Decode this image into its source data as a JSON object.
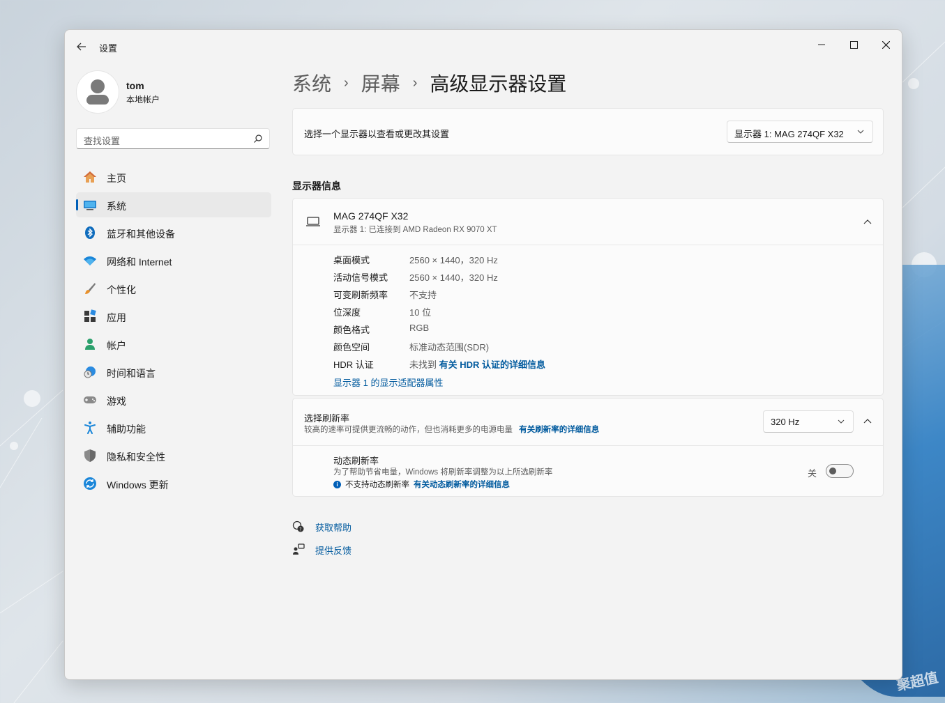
{
  "window": {
    "title": "设置"
  },
  "user": {
    "name": "tom",
    "account_type": "本地帐户"
  },
  "search": {
    "placeholder": "查找设置"
  },
  "nav": {
    "items": [
      {
        "label": "主页",
        "icon": "home-icon"
      },
      {
        "label": "系统",
        "icon": "system-icon",
        "active": true
      },
      {
        "label": "蓝牙和其他设备",
        "icon": "bluetooth-icon"
      },
      {
        "label": "网络和 Internet",
        "icon": "wifi-icon"
      },
      {
        "label": "个性化",
        "icon": "brush-icon"
      },
      {
        "label": "应用",
        "icon": "apps-icon"
      },
      {
        "label": "帐户",
        "icon": "account-icon"
      },
      {
        "label": "时间和语言",
        "icon": "globe-clock-icon"
      },
      {
        "label": "游戏",
        "icon": "gamepad-icon"
      },
      {
        "label": "辅助功能",
        "icon": "accessibility-icon"
      },
      {
        "label": "隐私和安全性",
        "icon": "shield-icon"
      },
      {
        "label": "Windows 更新",
        "icon": "update-icon"
      }
    ]
  },
  "breadcrumb": {
    "items": [
      "系统",
      "屏幕"
    ],
    "current": "高级显示器设置"
  },
  "monitor_select": {
    "label": "选择一个显示器以查看或更改其设置",
    "value": "显示器 1: MAG 274QF X32"
  },
  "display_info": {
    "section_title": "显示器信息",
    "monitor_name": "MAG 274QF X32",
    "monitor_sub": "显示器 1: 已连接到 AMD Radeon RX 9070 XT",
    "rows": [
      {
        "key": "桌面模式",
        "value": "2560 × 1440，320 Hz"
      },
      {
        "key": "活动信号模式",
        "value": "2560 × 1440，320 Hz"
      },
      {
        "key": "可变刷新频率",
        "value": "不支持"
      },
      {
        "key": "位深度",
        "value": "10 位"
      },
      {
        "key": "颜色格式",
        "value": "RGB"
      },
      {
        "key": "颜色空间",
        "value": "标准动态范围(SDR)"
      }
    ],
    "hdr": {
      "key": "HDR 认证",
      "value": "未找到",
      "link": "有关 HDR 认证的详细信息"
    },
    "adapter_link": "显示器 1 的显示适配器属性"
  },
  "refresh": {
    "title": "选择刷新率",
    "description": "较高的速率可提供更流畅的动作，但也消耗更多的电源电量",
    "link": "有关刷新率的详细信息",
    "value": "320 Hz",
    "dynamic": {
      "title": "动态刷新率",
      "description": "为了帮助节省电量，Windows 将刷新率调整为以上所选刷新率",
      "note": "不支持动态刷新率",
      "note_link": "有关动态刷新率的详细信息",
      "toggle_label": "关",
      "toggle_on": false
    }
  },
  "help": {
    "get_help": "获取帮助",
    "feedback": "提供反馈"
  },
  "watermark": "聚超值",
  "colors": {
    "accent": "#005fb8",
    "link": "#005a9e",
    "window_bg": "#f3f3f3",
    "card_bg": "#fbfbfb"
  }
}
